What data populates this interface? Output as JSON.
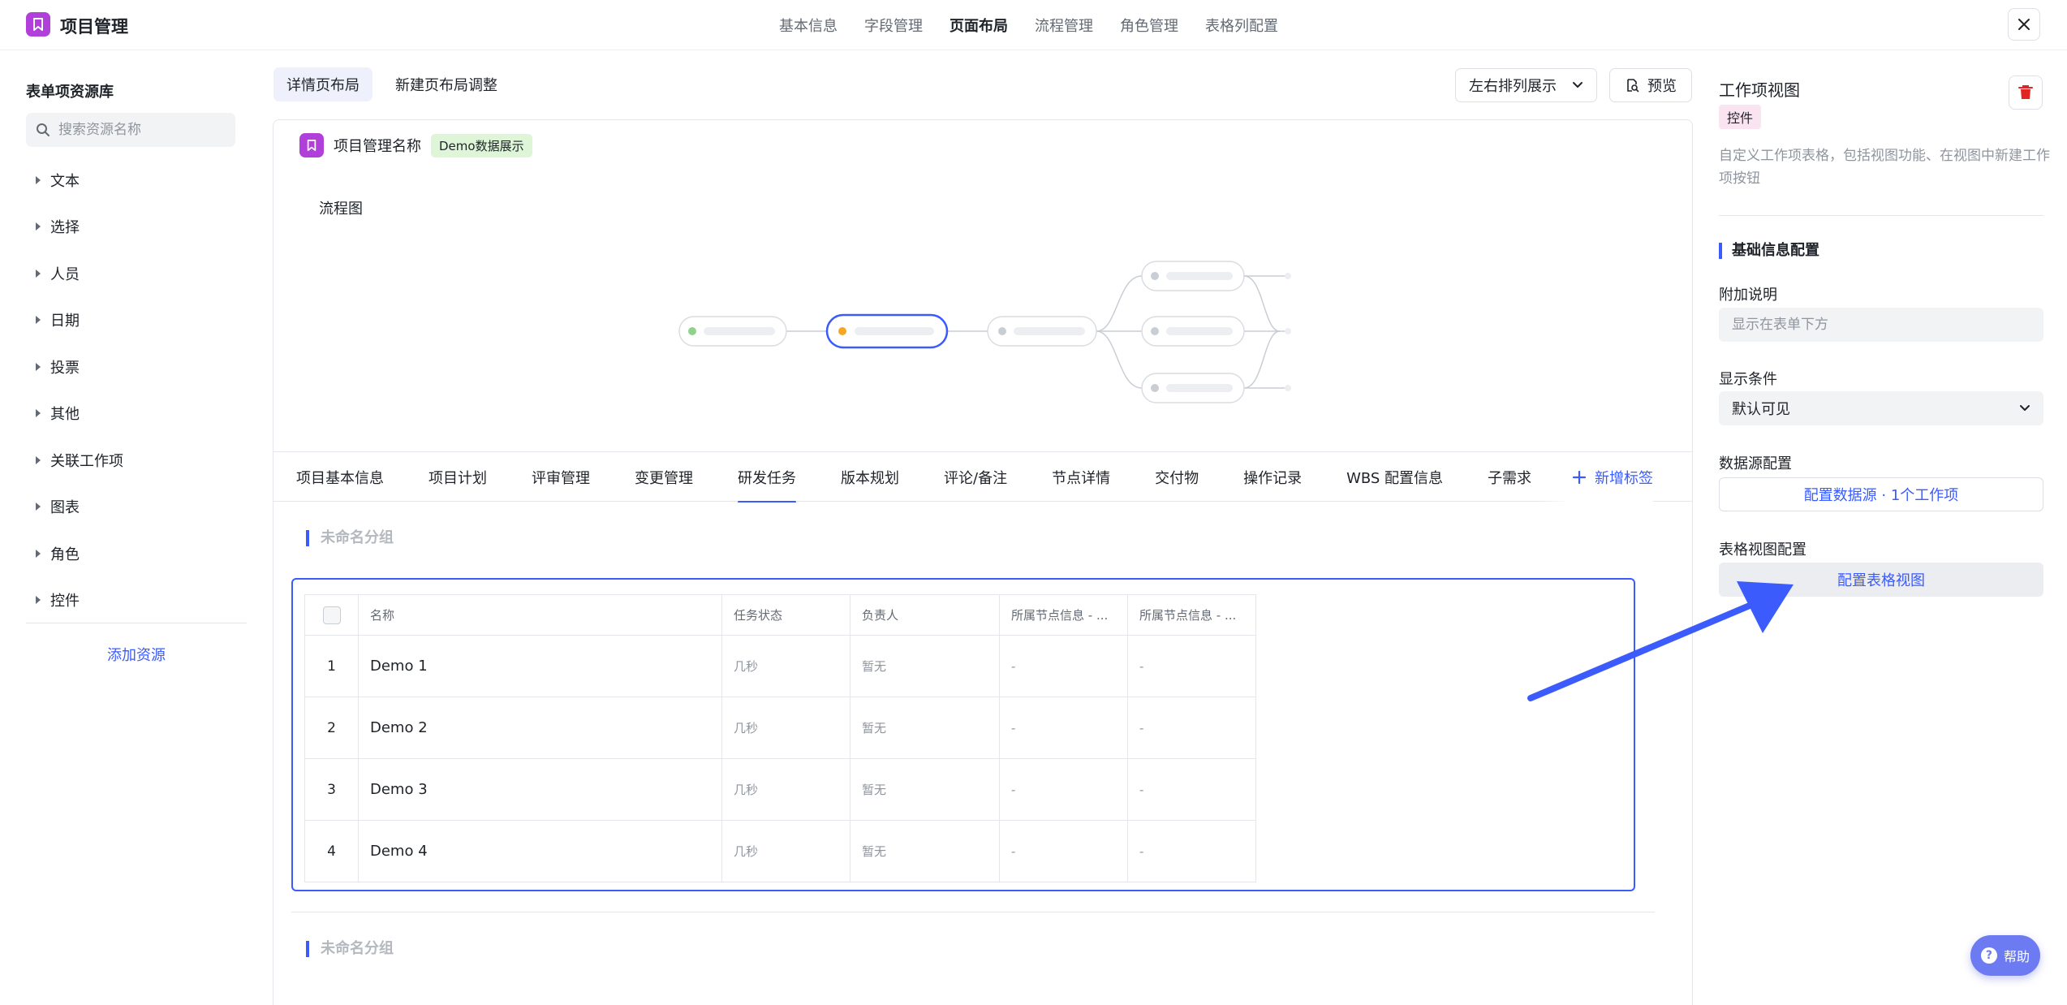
{
  "app": {
    "title": "项目管理"
  },
  "topnav": {
    "items": [
      "基本信息",
      "字段管理",
      "页面布局",
      "流程管理",
      "角色管理",
      "表格列配置"
    ],
    "active_index": 2
  },
  "sidebar": {
    "title": "表单项资源库",
    "search_placeholder": "搜索资源名称",
    "items": [
      "文本",
      "选择",
      "人员",
      "日期",
      "投票",
      "其他",
      "关联工作项",
      "图表",
      "角色",
      "控件"
    ],
    "add_label": "添加资源"
  },
  "layout_tabs": {
    "detail": "详情页布局",
    "new": "新建页布局调整"
  },
  "toolbar": {
    "arrange_label": "左右排列展示",
    "preview_label": "预览"
  },
  "canvas": {
    "title": "项目管理名称",
    "badge": "Demo数据展示",
    "flow_label": "流程图",
    "tabs": [
      "项目基本信息",
      "项目计划",
      "评审管理",
      "变更管理",
      "研发任务",
      "版本规划",
      "评论/备注",
      "节点详情",
      "交付物",
      "操作记录",
      "WBS 配置信息",
      "子需求"
    ],
    "active_tab_index": 4,
    "add_tab_label": "新增标签",
    "group1_title": "未命名分组",
    "group2_title": "未命名分组",
    "table": {
      "headers": [
        "名称",
        "任务状态",
        "负责人",
        "所属节点信息 - ...",
        "所属节点信息 - ..."
      ],
      "rows": [
        {
          "index": "1",
          "name": "Demo 1",
          "status": "几秒",
          "owner": "暂无",
          "node1": "-",
          "node2": "-"
        },
        {
          "index": "2",
          "name": "Demo 2",
          "status": "几秒",
          "owner": "暂无",
          "node1": "-",
          "node2": "-"
        },
        {
          "index": "3",
          "name": "Demo 3",
          "status": "几秒",
          "owner": "暂无",
          "node1": "-",
          "node2": "-"
        },
        {
          "index": "4",
          "name": "Demo 4",
          "status": "几秒",
          "owner": "暂无",
          "node1": "-",
          "node2": "-"
        }
      ]
    }
  },
  "right_panel": {
    "title": "工作项视图",
    "badge": "控件",
    "description": "自定义工作项表格，包括视图功能、在视图中新建工作项按钮",
    "section_title": "基础信息配置",
    "note_label": "附加说明",
    "note_placeholder": "显示在表单下方",
    "condition_label": "显示条件",
    "condition_value": "默认可见",
    "datasource_label": "数据源配置",
    "datasource_button": "配置数据源 · 1个工作项",
    "tableview_label": "表格视图配置",
    "tableview_button": "配置表格视图"
  },
  "help": {
    "label": "帮助"
  },
  "colors": {
    "accent": "#3b5bfd",
    "logo": "#b13fd9",
    "delete": "#e02424",
    "help": "#6d7bf2"
  }
}
